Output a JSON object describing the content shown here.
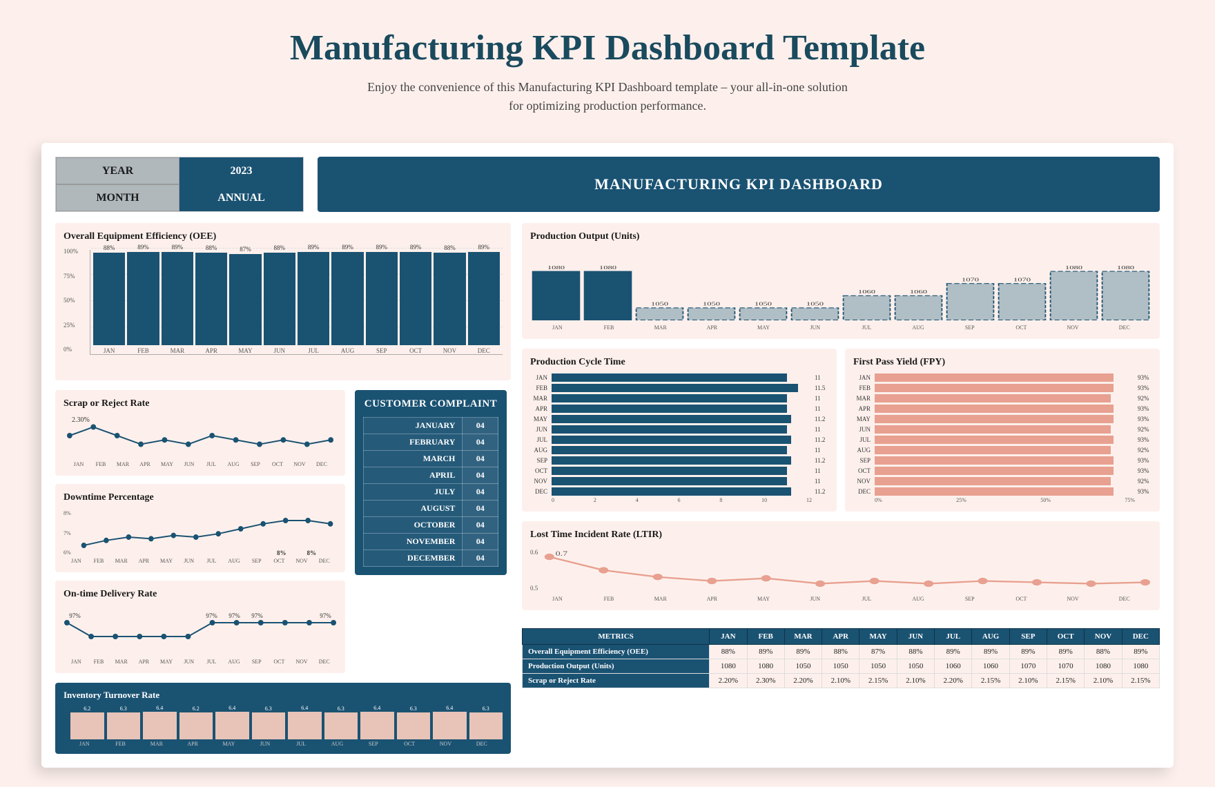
{
  "header": {
    "title": "Manufacturing KPI Dashboard Template",
    "subtitle": "Enjoy the convenience of this Manufacturing KPI Dashboard template – your all-in-one solution for optimizing production performance."
  },
  "dashboard": {
    "year_label": "YEAR",
    "year_value": "2023",
    "month_label": "MONTH",
    "month_value": "ANNUAL",
    "banner_title": "MANUFACTURING KPI DASHBOARD"
  },
  "oee": {
    "title": "Overall Equipment Efficiency (OEE)",
    "y_labels": [
      "100%",
      "75%",
      "50%",
      "25%",
      "0%"
    ],
    "bars": [
      {
        "month": "JAN",
        "value": 88,
        "pct": 88
      },
      {
        "month": "FEB",
        "value": 89,
        "pct": 89
      },
      {
        "month": "MAR",
        "value": 89,
        "pct": 89
      },
      {
        "month": "APR",
        "value": 88,
        "pct": 88
      },
      {
        "month": "MAY",
        "value": 87,
        "pct": 87
      },
      {
        "month": "JUN",
        "value": 88,
        "pct": 88
      },
      {
        "month": "JUL",
        "value": 89,
        "pct": 89
      },
      {
        "month": "AUG",
        "value": 89,
        "pct": 89
      },
      {
        "month": "SEP",
        "value": 89,
        "pct": 89
      },
      {
        "month": "OCT",
        "value": 89,
        "pct": 89
      },
      {
        "month": "NOV",
        "value": 88,
        "pct": 88
      },
      {
        "month": "DEC",
        "value": 89,
        "pct": 89
      }
    ]
  },
  "scrap": {
    "title": "Scrap or Reject Rate",
    "highlight_value": "2.30%",
    "months": [
      "JAN",
      "FEB",
      "MAR",
      "APR",
      "MAY",
      "JUN",
      "JUL",
      "AUG",
      "SEP",
      "OCT",
      "NOV",
      "DEC"
    ],
    "values": [
      2.2,
      2.3,
      2.2,
      2.1,
      2.15,
      2.1,
      2.2,
      2.15,
      2.1,
      2.15,
      2.1,
      2.15
    ]
  },
  "downtime": {
    "title": "Downtime Percentage",
    "y_labels": [
      "8%",
      "7%",
      "6%"
    ],
    "months": [
      "JAN",
      "FEB",
      "MAR",
      "APR",
      "MAY",
      "JUN",
      "JUL",
      "AUG",
      "SEP",
      "OCT",
      "NOV",
      "DEC"
    ],
    "values": [
      6.5,
      6.8,
      7.0,
      6.9,
      7.1,
      7.0,
      7.2,
      7.5,
      7.8,
      8,
      8,
      7.8
    ],
    "highlight_values": [
      "8%",
      "8%"
    ]
  },
  "on_time_delivery": {
    "title": "On-time Delivery Rate",
    "months": [
      "JAN",
      "FEB",
      "MAR",
      "APR",
      "MAY",
      "JUN",
      "JUL",
      "AUG",
      "SEP",
      "OCT",
      "NOV",
      "DEC"
    ],
    "values": [
      97,
      96,
      96,
      96,
      96,
      96,
      97,
      97,
      97,
      97,
      97,
      97
    ],
    "labeled": [
      "97%",
      "",
      "",
      "",
      "",
      "",
      "97%",
      "97%",
      "97%",
      "",
      "",
      "97%"
    ]
  },
  "customer_complaint": {
    "title": "CUSTOMER COMPLAINT",
    "rows": [
      {
        "month": "JANUARY",
        "value": "04"
      },
      {
        "month": "FEBRUARY",
        "value": "04"
      },
      {
        "month": "MARCH",
        "value": "04"
      },
      {
        "month": "APRIL",
        "value": "04"
      },
      {
        "month": "JULY",
        "value": "04"
      },
      {
        "month": "AUGUST",
        "value": "04"
      },
      {
        "month": "OCTOBER",
        "value": "04"
      },
      {
        "month": "NOVEMBER",
        "value": "04"
      },
      {
        "month": "DECEMBER",
        "value": "04"
      }
    ]
  },
  "production_output": {
    "title": "Production Output (Units)",
    "months": [
      "JAN",
      "FEB",
      "MAR",
      "APR",
      "MAY",
      "JUN",
      "JUL",
      "AUG",
      "SEP",
      "OCT",
      "NOV",
      "DEC"
    ],
    "values": [
      1080,
      1080,
      1050,
      1050,
      1050,
      1050,
      1060,
      1060,
      1070,
      1070,
      1080,
      1080
    ]
  },
  "cycle_time": {
    "title": "Production Cycle Time",
    "months": [
      "JAN",
      "FEB",
      "MAR",
      "APR",
      "MAY",
      "JUN",
      "JUL",
      "AUG",
      "SEP",
      "OCT",
      "NOV",
      "DEC"
    ],
    "values": [
      11,
      11.5,
      11,
      11,
      11.2,
      11,
      11.2,
      11,
      11.2,
      11,
      11,
      11.2
    ],
    "x_labels": [
      "0",
      "2",
      "4",
      "6",
      "8",
      "10",
      "12"
    ]
  },
  "fpy": {
    "title": "First Pass Yield (FPY)",
    "months": [
      "JAN",
      "FEB",
      "MAR",
      "APR",
      "MAY",
      "JUN",
      "JUL",
      "AUG",
      "SEP",
      "OCT",
      "NOV",
      "DEC"
    ],
    "values": [
      93,
      93,
      92,
      93,
      93,
      92,
      93,
      92,
      93,
      93,
      92,
      93
    ],
    "x_labels": [
      "0%",
      "25%",
      "50%",
      "75%"
    ]
  },
  "ltir": {
    "title": "Lost Time Incident Rate (LTIR)",
    "months": [
      "JAN",
      "FEB",
      "MAR",
      "APR",
      "MAY",
      "JUN",
      "JUL",
      "AUG",
      "SEP",
      "OCT",
      "NOV",
      "DEC"
    ],
    "values": [
      0.7,
      0.6,
      0.55,
      0.52,
      0.54,
      0.5,
      0.52,
      0.5,
      0.52,
      0.51,
      0.5,
      0.51
    ],
    "y_labels": [
      "0.6",
      "0.5"
    ]
  },
  "inventory": {
    "title": "Inventory Turnover Rate",
    "months": [
      "JAN",
      "FEB",
      "MAR",
      "APR",
      "MAY",
      "JUN",
      "JUL",
      "AUG",
      "SEP",
      "OCT",
      "NOV",
      "DEC"
    ],
    "values": [
      6.2,
      6.3,
      6.4,
      6.2,
      6.4,
      6.3,
      6.4,
      6.3,
      6.4,
      6.3,
      6.4,
      6.3
    ],
    "y_max": 8
  },
  "bottom_table": {
    "headers": [
      "METRICS",
      "JAN",
      "FEB",
      "MAR",
      "APR",
      "MAY",
      "JUN",
      "JUL",
      "AUG",
      "SEP",
      "OCT",
      "NOV",
      "DEC"
    ],
    "rows": [
      {
        "label": "Overall Equipment Efficiency (OEE)",
        "values": [
          "88%",
          "89%",
          "89%",
          "88%",
          "87%",
          "88%",
          "89%",
          "89%",
          "89%",
          "89%",
          "88%",
          "89%"
        ]
      },
      {
        "label": "Production Output (Units)",
        "values": [
          "1080",
          "1080",
          "1050",
          "1050",
          "1050",
          "1050",
          "1060",
          "1060",
          "1070",
          "1070",
          "1080",
          "1080"
        ]
      },
      {
        "label": "Scrap or Reject Rate",
        "values": [
          "2.20%",
          "2.30%",
          "2.20%",
          "2.10%",
          "2.15%",
          "2.10%",
          "2.20%",
          "2.15%",
          "2.10%",
          "2.15%",
          "2.10%",
          "2.15%"
        ]
      }
    ]
  }
}
